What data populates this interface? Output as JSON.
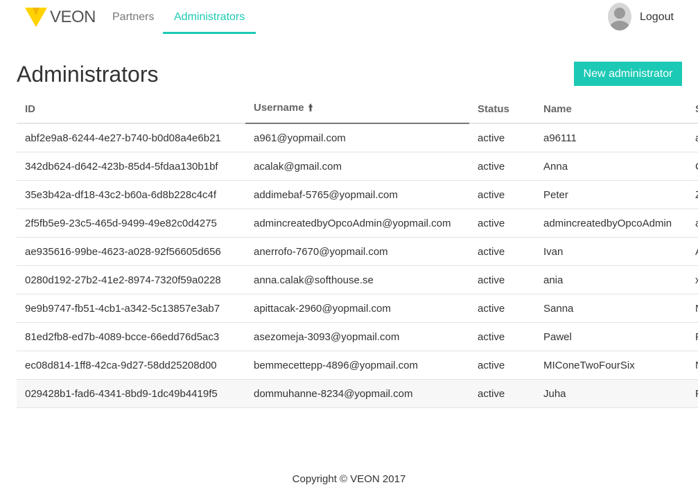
{
  "nav": {
    "logo_text": "VEON",
    "links": [
      {
        "label": "Partners",
        "active": false
      },
      {
        "label": "Administrators",
        "active": true
      }
    ],
    "logout_label": "Logout"
  },
  "page": {
    "title": "Administrators",
    "new_button_label": "New administrator"
  },
  "table": {
    "columns": [
      {
        "label": "ID"
      },
      {
        "label": "Username",
        "sort": "ascending"
      },
      {
        "label": "Status"
      },
      {
        "label": "Name"
      },
      {
        "label": "S"
      }
    ],
    "rows": [
      {
        "id": "abf2e9a8-6244-4e27-b740-b0d08a4e6b21",
        "username": "a961@yopmail.com",
        "status": "active",
        "name": "a96111",
        "s": "a"
      },
      {
        "id": "342db624-d642-423b-85d4-5fdaa130b1bf",
        "username": "acalak@gmail.com",
        "status": "active",
        "name": "Anna",
        "s": "C"
      },
      {
        "id": "35e3b42a-df18-43c2-b60a-6d8b228c4c4f",
        "username": "addimebaf-5765@yopmail.com",
        "status": "active",
        "name": "Peter",
        "s": "Z"
      },
      {
        "id": "2f5fb5e9-23c5-465d-9499-49e82c0d4275",
        "username": "admincreatedbyOpcoAdmin@yopmail.com",
        "status": "active",
        "name": "admincreatedbyOpcoAdmin",
        "s": "a"
      },
      {
        "id": "ae935616-99be-4623-a028-92f56605d656",
        "username": "anerrofo-7670@yopmail.com",
        "status": "active",
        "name": "Ivan",
        "s": "A"
      },
      {
        "id": "0280d192-27b2-41e2-8974-7320f59a0228",
        "username": "anna.calak@softhouse.se",
        "status": "active",
        "name": "ania",
        "s": "x"
      },
      {
        "id": "9e9b9747-fb51-4cb1-a342-5c13857e3ab7",
        "username": "apittacak-2960@yopmail.com",
        "status": "active",
        "name": "Sanna",
        "s": "N"
      },
      {
        "id": "81ed2fb8-ed7b-4089-bcce-66edd76d5ac3",
        "username": "asezomeja-3093@yopmail.com",
        "status": "active",
        "name": "Pawel",
        "s": "F"
      },
      {
        "id": "ec08d814-1ff8-42ca-9d27-58dd25208d00",
        "username": "bemmecettepp-4896@yopmail.com",
        "status": "active",
        "name": "MIConeTwoFourSix",
        "s": "N"
      },
      {
        "id": "029428b1-fad6-4341-8bd9-1dc49b4419f5",
        "username": "dommuhanne-8234@yopmail.com",
        "status": "active",
        "name": "Juha",
        "s": "F"
      }
    ]
  },
  "footer": {
    "text": "Copyright © VEON 2017"
  },
  "colors": {
    "accent": "#1cc9b4",
    "logo_yellow": "#ffd200"
  }
}
